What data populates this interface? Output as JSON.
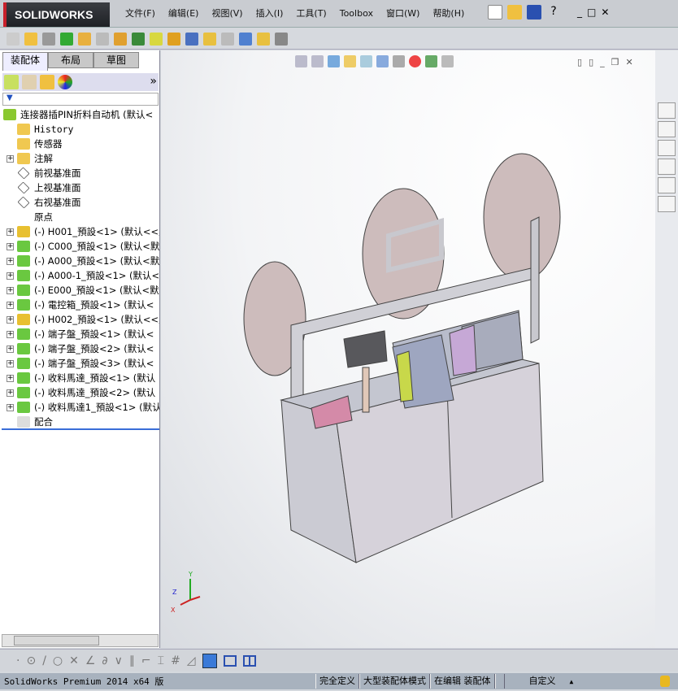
{
  "app": {
    "logo": "SOLIDWORKS"
  },
  "menu": [
    "文件(F)",
    "编辑(E)",
    "视图(V)",
    "插入(I)",
    "工具(T)",
    "Toolbox",
    "窗口(W)",
    "帮助(H)"
  ],
  "left_panel": {
    "tabs": [
      "装配体",
      "布局",
      "草图"
    ],
    "more": "»",
    "tree": [
      {
        "label": "连接器插PIN折料自动机 (默认<",
        "icon": "assembly-icon",
        "expand": false,
        "root": true
      },
      {
        "label": "History",
        "icon": "history-folder-icon",
        "expand": false
      },
      {
        "label": "传感器",
        "icon": "sensor-folder-icon",
        "expand": false
      },
      {
        "label": "注解",
        "icon": "annotation-folder-icon",
        "expand": true
      },
      {
        "label": "前视基准面",
        "icon": "plane-icon",
        "expand": false
      },
      {
        "label": "上视基准面",
        "icon": "plane-icon",
        "expand": false
      },
      {
        "label": "右视基准面",
        "icon": "plane-icon",
        "expand": false
      },
      {
        "label": "原点",
        "icon": "origin-icon",
        "expand": false
      },
      {
        "label": "(-) H001_預設<1> (默认<<默",
        "icon": "part-icon",
        "expand": true
      },
      {
        "label": "(-) C000_預設<1> (默认<默",
        "icon": "subassembly-icon",
        "expand": true
      },
      {
        "label": "(-) A000_預設<1> (默认<默",
        "icon": "subassembly-icon",
        "expand": true
      },
      {
        "label": "(-) A000-1_預設<1> (默认<",
        "icon": "subassembly-icon",
        "expand": true
      },
      {
        "label": "(-) E000_預設<1> (默认<默",
        "icon": "subassembly-icon",
        "expand": true
      },
      {
        "label": "(-) 電控箱_預設<1> (默认<",
        "icon": "subassembly-icon",
        "expand": true
      },
      {
        "label": "(-) H002_預設<1> (默认<<默",
        "icon": "part-icon",
        "expand": true
      },
      {
        "label": "(-) 端子盤_預設<1> (默认<",
        "icon": "subassembly-icon",
        "expand": true
      },
      {
        "label": "(-) 端子盤_預設<2> (默认<",
        "icon": "subassembly-icon",
        "expand": true
      },
      {
        "label": "(-) 端子盤_預設<3> (默认<",
        "icon": "subassembly-icon",
        "expand": true
      },
      {
        "label": "(-) 收料馬達_預設<1> (默认",
        "icon": "subassembly-icon",
        "expand": true
      },
      {
        "label": "(-) 收料馬達_預設<2> (默认",
        "icon": "subassembly-icon",
        "expand": true
      },
      {
        "label": "(-) 收料馬達1_預設<1> (默认",
        "icon": "subassembly-icon",
        "expand": true
      },
      {
        "label": "配合",
        "icon": "mates-icon",
        "expand": false
      }
    ]
  },
  "status": {
    "version": "SolidWorks Premium 2014 x64 版",
    "state": "完全定义",
    "mode": "大型装配体模式",
    "editing": "在编辑 装配体",
    "units": "自定义",
    "arrow": "▲"
  },
  "triad": {
    "x": "X",
    "y": "Y",
    "z": "Z"
  },
  "colors": {
    "accent": "#3a6ed8",
    "logo_red": "#c8202a"
  }
}
